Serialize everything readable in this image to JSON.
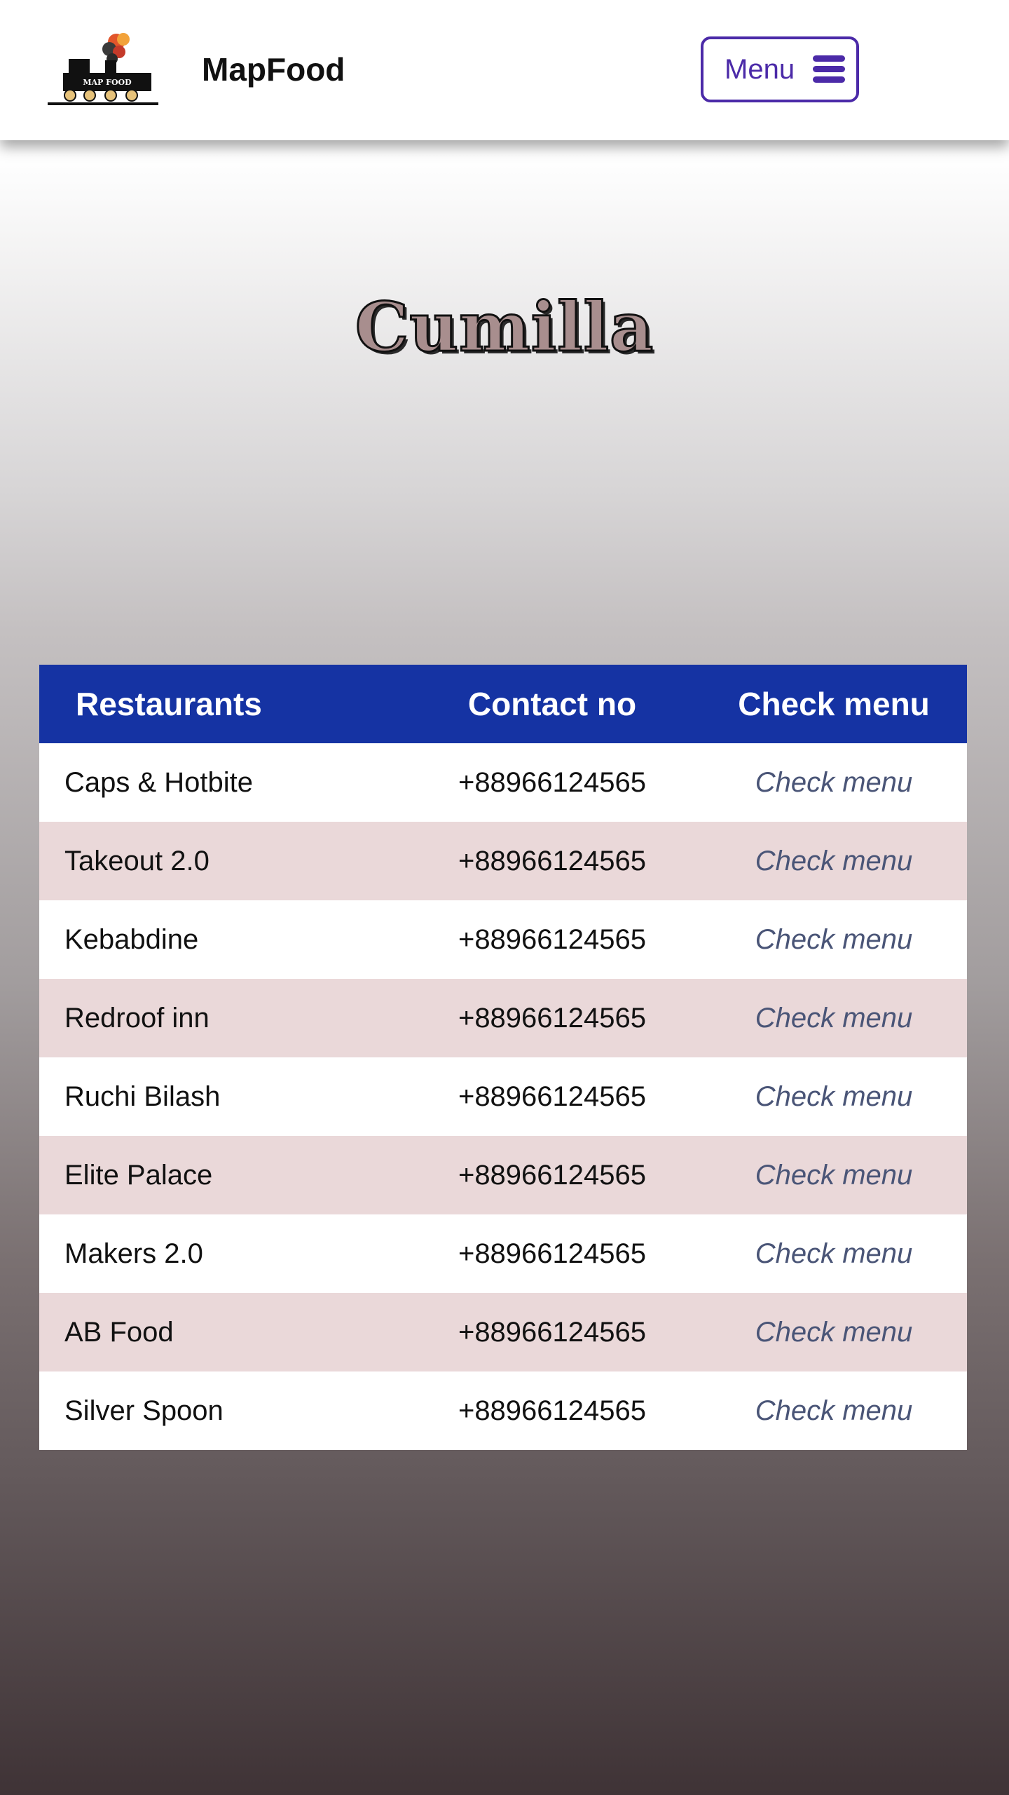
{
  "header": {
    "brand": "MapFood",
    "logo_text": "MAP FOOD",
    "menu_label": "Menu"
  },
  "page_title": "Cumilla",
  "table": {
    "columns": [
      "Restaurants",
      "Contact no",
      "Check menu"
    ],
    "rows": [
      {
        "name": "Caps & Hotbite",
        "contact": "+88966124565",
        "action": "Check menu"
      },
      {
        "name": "Takeout 2.0",
        "contact": "+88966124565",
        "action": "Check menu"
      },
      {
        "name": "Kebabdine",
        "contact": "+88966124565",
        "action": "Check menu"
      },
      {
        "name": "Redroof inn",
        "contact": "+88966124565",
        "action": "Check menu"
      },
      {
        "name": "Ruchi Bilash",
        "contact": "+88966124565",
        "action": "Check menu"
      },
      {
        "name": "Elite Palace",
        "contact": "+88966124565",
        "action": "Check menu"
      },
      {
        "name": "Makers 2.0",
        "contact": "+88966124565",
        "action": "Check menu"
      },
      {
        "name": "AB Food",
        "contact": "+88966124565",
        "action": "Check menu"
      },
      {
        "name": "Silver Spoon",
        "contact": "+88966124565",
        "action": "Check menu"
      }
    ]
  },
  "colors": {
    "header_bg": "#ffffff",
    "accent_purple": "#4b2aa8",
    "table_header_bg": "#1533a3",
    "row_alt_bg": "#ead8d9",
    "link_color": "#4a5577"
  }
}
